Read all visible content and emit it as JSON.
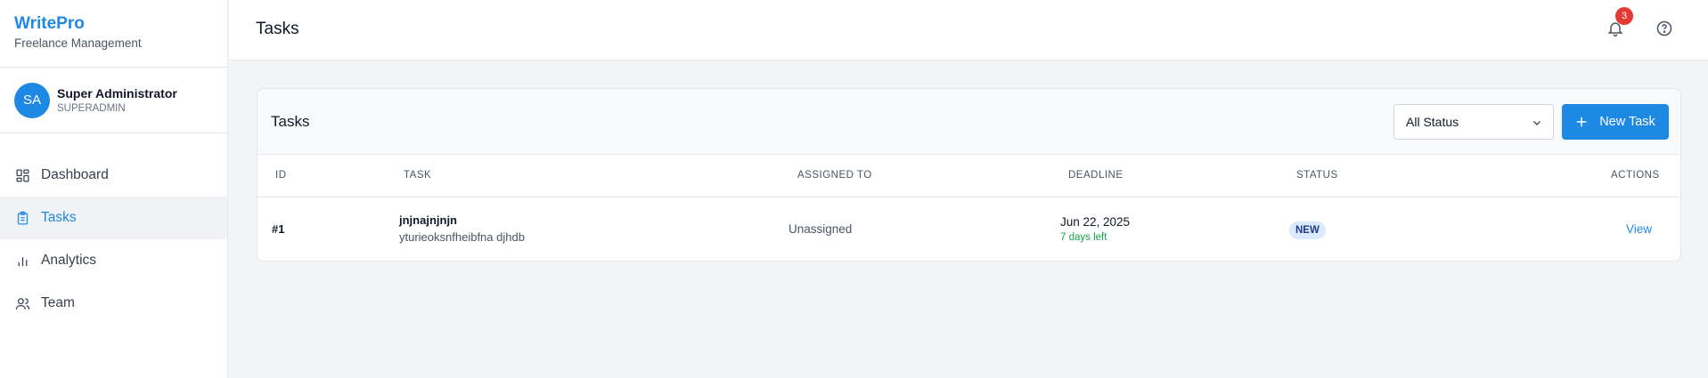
{
  "brand": {
    "name": "WritePro",
    "subtitle": "Freelance Management"
  },
  "user": {
    "initials": "SA",
    "name": "Super Administrator",
    "role": "SUPERADMIN"
  },
  "sidebar": {
    "items": [
      {
        "label": "Dashboard",
        "icon": "dashboard-icon",
        "active": false
      },
      {
        "label": "Tasks",
        "icon": "clipboard-icon",
        "active": true
      },
      {
        "label": "Analytics",
        "icon": "bar-chart-icon",
        "active": false
      },
      {
        "label": "Team",
        "icon": "users-icon",
        "active": false
      }
    ]
  },
  "topbar": {
    "title": "Tasks",
    "notification_count": "3"
  },
  "panel": {
    "title": "Tasks",
    "status_filter": "All Status",
    "new_task_label": "New Task"
  },
  "table": {
    "columns": [
      "ID",
      "TASK",
      "ASSIGNED TO",
      "DEADLINE",
      "STATUS",
      "ACTIONS"
    ],
    "rows": [
      {
        "id": "#1",
        "task_name": "jnjnajnjnjn",
        "task_description": "yturieoksnfheibfna djhdb",
        "assigned_to": "Unassigned",
        "deadline": "Jun 22, 2025",
        "days_left": "7 days left",
        "status": "NEW",
        "action": "View"
      }
    ]
  },
  "colors": {
    "accent": "#1e88e5",
    "badge": "#e53935",
    "days_left": "#16a34a",
    "status_pill_bg": "#dbeafe"
  }
}
